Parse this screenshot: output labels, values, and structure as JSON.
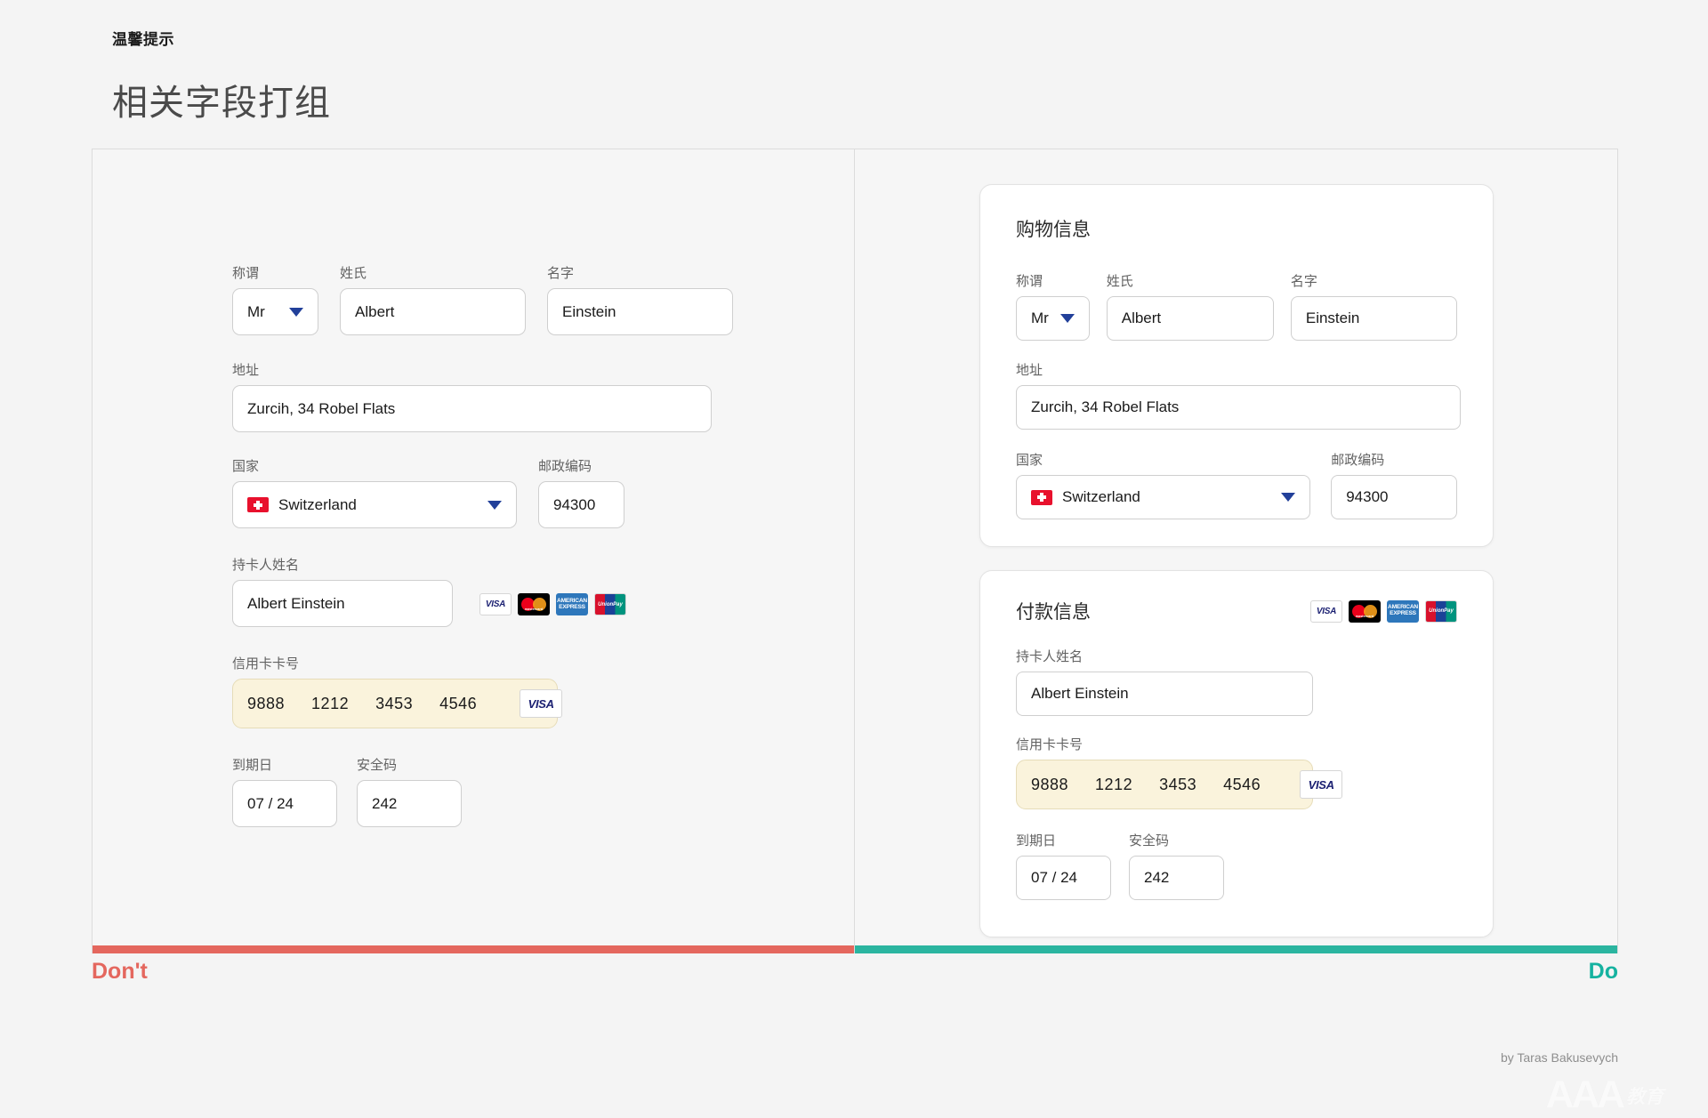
{
  "header": {
    "eyebrow": "温馨提示",
    "title": "相关字段打组"
  },
  "verdict": {
    "dont": "Don't",
    "do": "Do",
    "dont_color": "#e4675e",
    "do_color": "#16b2a0"
  },
  "labels": {
    "salutation": "称谓",
    "first_name": "姓氏",
    "last_name": "名字",
    "address": "地址",
    "country": "国家",
    "postal_code": "邮政编码",
    "cardholder": "持卡人姓名",
    "card_number": "信用卡卡号",
    "expiry": "到期日",
    "cvc": "安全码"
  },
  "values": {
    "salutation": "Mr",
    "first_name": "Albert",
    "last_name": "Einstein",
    "address": "Zurcih, 34 Robel Flats",
    "country": "Switzerland",
    "postal_code": "94300",
    "cardholder": "Albert Einstein",
    "card_group_1": "9888",
    "card_group_2": "1212",
    "card_group_3": "3453",
    "card_group_4": "4546",
    "expiry": "07 / 24",
    "cvc": "242"
  },
  "cards": {
    "shopping_title": "购物信息",
    "payment_title": "付款信息"
  },
  "brands": {
    "visa": "VISA",
    "mastercard_name": "mastercard",
    "amex_line1": "AMERICAN",
    "amex_line2": "EXPRESS",
    "unionpay": "UnionPay"
  },
  "footer": {
    "credit": "by Taras Bakusevych",
    "watermark_text": "AAA",
    "watermark_cn": "教育"
  }
}
